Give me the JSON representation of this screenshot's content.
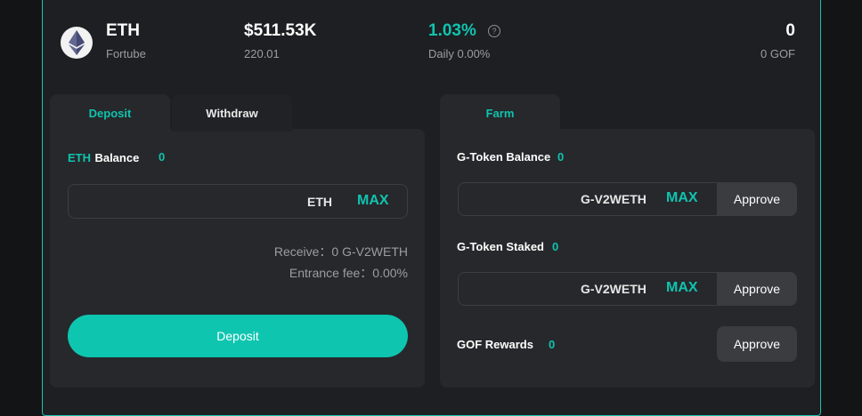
{
  "header": {
    "asset_symbol": "ETH",
    "asset_platform": "Fortube",
    "tvl": "$511.53K",
    "tvl_sub": "220.01",
    "apy": "1.03%",
    "daily": "Daily 0.00%",
    "reward_value": "0",
    "reward_token": "0 GOF",
    "help_glyph": "?"
  },
  "deposit_panel": {
    "tabs": [
      "Deposit",
      "Withdraw"
    ],
    "balance_token": "ETH",
    "balance_label": "Balance",
    "balance_value": "0",
    "input_token": "ETH",
    "max_label": "MAX",
    "receive_text": "Receive：0 G-V2WETH",
    "fee_text": "Entrance fee：0.00%",
    "deposit_button": "Deposit"
  },
  "farm_panel": {
    "tab": "Farm",
    "gtoken_balance_label": "G-Token Balance",
    "gtoken_balance_value": "0",
    "input1_token": "G-V2WETH",
    "input1_max": "MAX",
    "approve1": "Approve",
    "gtoken_staked_label": "G-Token Staked",
    "gtoken_staked_value": "0",
    "input2_token": "G-V2WETH",
    "input2_max": "MAX",
    "approve2": "Approve",
    "gof_rewards_label": "GOF Rewards",
    "gof_rewards_value": "0",
    "approve3": "Approve"
  },
  "icons": {
    "coin": "ethereum-logo-icon",
    "help": "question-circle-icon"
  },
  "colors": {
    "accent": "#10c3af",
    "background": "#1d1f22",
    "panel": "#26282b"
  }
}
